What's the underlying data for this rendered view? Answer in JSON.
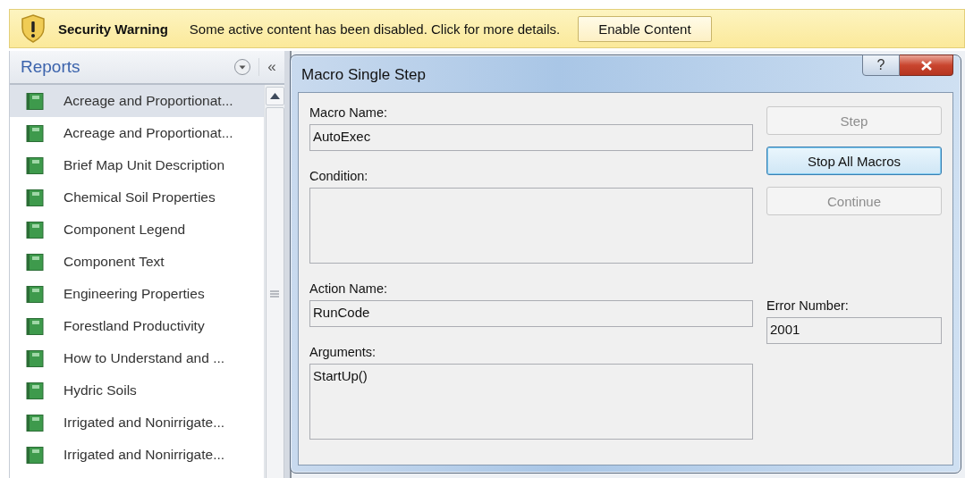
{
  "security_bar": {
    "title": "Security Warning",
    "message": "Some active content has been disabled. Click for more details.",
    "button": "Enable Content"
  },
  "navigation_pane": {
    "title": "Reports",
    "collapse": "«",
    "items": [
      {
        "label": "Acreage and Proportionat...",
        "selected": true
      },
      {
        "label": "Acreage and Proportionat...",
        "selected": false
      },
      {
        "label": "Brief Map Unit Description",
        "selected": false
      },
      {
        "label": "Chemical Soil Properties",
        "selected": false
      },
      {
        "label": "Component Legend",
        "selected": false
      },
      {
        "label": "Component Text",
        "selected": false
      },
      {
        "label": "Engineering Properties",
        "selected": false
      },
      {
        "label": "Forestland Productivity",
        "selected": false
      },
      {
        "label": "How to Understand and ...",
        "selected": false
      },
      {
        "label": "Hydric Soils",
        "selected": false
      },
      {
        "label": "Irrigated and Nonirrigate...",
        "selected": false
      },
      {
        "label": "Irrigated and Nonirrigate...",
        "selected": false
      }
    ]
  },
  "dialog": {
    "title": "Macro Single Step",
    "help": "?",
    "fields": [
      {
        "label": "Macro Name:",
        "value": "AutoExec",
        "kind": "line"
      },
      {
        "label": "Condition:",
        "kind": "box"
      },
      {
        "label": "Action Name:",
        "value": "RunCode",
        "kind": "line"
      },
      {
        "label": "Arguments:",
        "value": "StartUp()",
        "kind": "box"
      }
    ],
    "buttons": [
      {
        "label": "Step",
        "disabled": true,
        "default": false
      },
      {
        "label": "Stop All Macros",
        "disabled": false,
        "default": true
      },
      {
        "label": "Continue",
        "disabled": true,
        "default": false
      }
    ],
    "error": {
      "label": "Error Number:",
      "value": "2001"
    }
  }
}
